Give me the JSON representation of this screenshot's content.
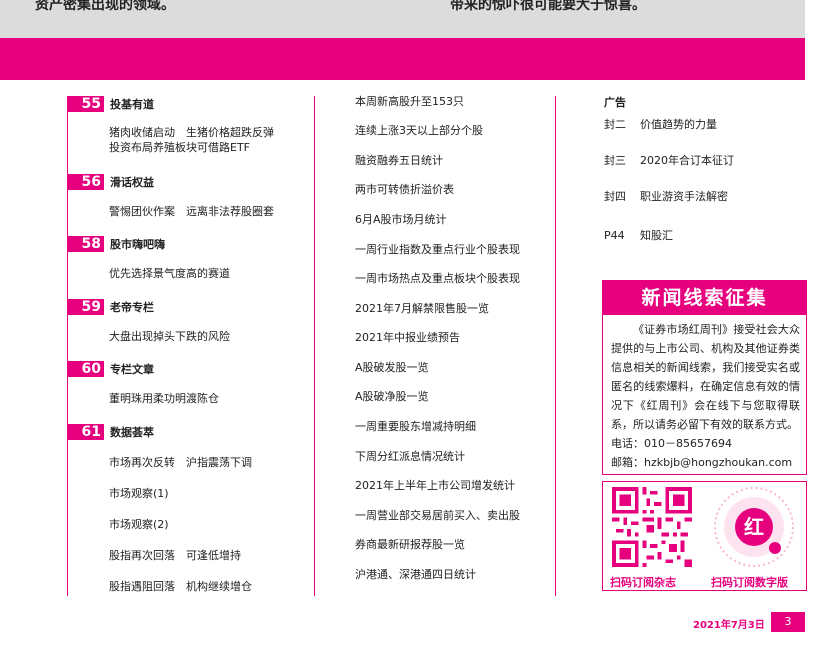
{
  "top": {
    "left_text": "资产密集出现的领域。",
    "right_text": "带来的惊吓很可能要大于惊喜。"
  },
  "sections": [
    {
      "num": "55",
      "title": "投基有道",
      "articles": [
        "猪肉收储启动　生猪价格超跌反弹",
        "投资布局养殖板块可借路ETF"
      ]
    },
    {
      "num": "56",
      "title": "滑话权益",
      "articles": [
        "警惕团伙作案　远离非法荐股圈套"
      ]
    },
    {
      "num": "58",
      "title": "股市嗨吧嗨",
      "articles": [
        "优先选择景气度高的赛道"
      ]
    },
    {
      "num": "59",
      "title": "老帝专栏",
      "articles": [
        "大盘出现掉头下跌的风险"
      ]
    },
    {
      "num": "60",
      "title": "专栏文章",
      "articles": [
        "董明珠用柔功明渡陈仓"
      ]
    },
    {
      "num": "61",
      "title": "数据荟萃",
      "articles": [
        "市场再次反转　沪指震荡下调",
        "市场观察(1)",
        "市场观察(2)",
        "股指再次回落　可逢低增持",
        "股指遇阻回落　机构继续增仓"
      ]
    }
  ],
  "middle": [
    "本周新高股升至153只",
    "连续上涨3天以上部分个股",
    "融资融券五日统计",
    "两市可转债折溢价表",
    "6月A股市场月统计",
    "一周行业指数及重点行业个股表现",
    "一周市场热点及重点板块个股表现",
    "2021年7月解禁限售股一览",
    "2021年中报业绩预告",
    "A股破发股一览",
    "A股破净股一览",
    "一周重要股东增减持明细",
    "下周分红派息情况统计",
    "2021年上半年上市公司增发统计",
    "一周营业部交易居前买入、卖出股",
    "券商最新研报荐股一览",
    "沪港通、深港通四日统计"
  ],
  "ads": {
    "heading": "广告",
    "items": [
      {
        "page": "封二",
        "title": "价值趋势的力量"
      },
      {
        "page": "封三",
        "title": "2020年合订本征订"
      },
      {
        "page": "封四",
        "title": "职业游资手法解密"
      },
      {
        "page": "P44",
        "title": "知股汇"
      }
    ]
  },
  "news_box": {
    "title": "新闻线索征集",
    "body": "《证券市场红周刊》接受社会大众提供的与上市公司、机构及其他证券类信息相关的新闻线索，我们接受实名或匿名的线索爆料，在确定信息有效的情况下《红周刊》会在线下与您取得联系，所以请务必留下有效的联系方式。",
    "phone": "电话：010－85657694",
    "email": "邮箱：hzkbjb@hongzhoukan.com"
  },
  "qr": {
    "caption_left": "扫码订阅杂志",
    "caption_right": "扫码订阅数字版",
    "logo_char": "红"
  },
  "footer": {
    "date": "2021年7月3日",
    "page": "3"
  },
  "colors": {
    "accent": "#e6007e",
    "band": "#dcdcdc"
  }
}
